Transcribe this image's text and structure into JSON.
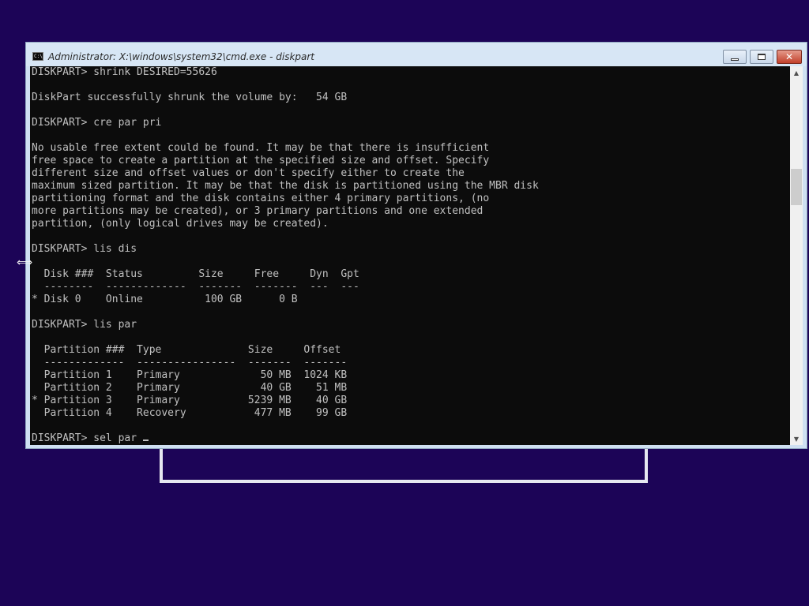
{
  "window": {
    "title": "Administrator: X:\\windows\\system32\\cmd.exe - diskpart",
    "icon_text": "C:\\"
  },
  "controls": {
    "minimize_icon": "minimize-icon",
    "maximize_icon": "maximize-icon",
    "close_glyph": "✕"
  },
  "console": {
    "lines": [
      "DISKPART> shrink DESIRED=55626",
      "",
      "DiskPart successfully shrunk the volume by:   54 GB",
      "",
      "DISKPART> cre par pri",
      "",
      "No usable free extent could be found. It may be that there is insufficient",
      "free space to create a partition at the specified size and offset. Specify",
      "different size and offset values or don't specify either to create the",
      "maximum sized partition. It may be that the disk is partitioned using the MBR disk",
      "partitioning format and the disk contains either 4 primary partitions, (no",
      "more partitions may be created), or 3 primary partitions and one extended",
      "partition, (only logical drives may be created).",
      "",
      "DISKPART> lis dis",
      "",
      "  Disk ###  Status         Size     Free     Dyn  Gpt",
      "  --------  -------------  -------  -------  ---  ---",
      "* Disk 0    Online          100 GB      0 B",
      "",
      "DISKPART> lis par",
      "",
      "  Partition ###  Type              Size     Offset",
      "  -------------  ----------------  -------  -------",
      "  Partition 1    Primary             50 MB  1024 KB",
      "  Partition 2    Primary             40 GB    51 MB",
      "* Partition 3    Primary           5239 MB    40 GB",
      "  Partition 4    Recovery           477 MB    99 GB",
      ""
    ],
    "prompt_line": "DISKPART> sel par "
  },
  "scrollbar": {
    "up_arrow": "▲",
    "down_arrow": "▼"
  },
  "cursor_glyph": "⟺",
  "colors": {
    "desktop": "#1c0457",
    "console_bg": "#0c0c0c",
    "console_text": "#c0c0c0",
    "titlebar": "#d7e6f5",
    "close_button": "#c2402a"
  }
}
